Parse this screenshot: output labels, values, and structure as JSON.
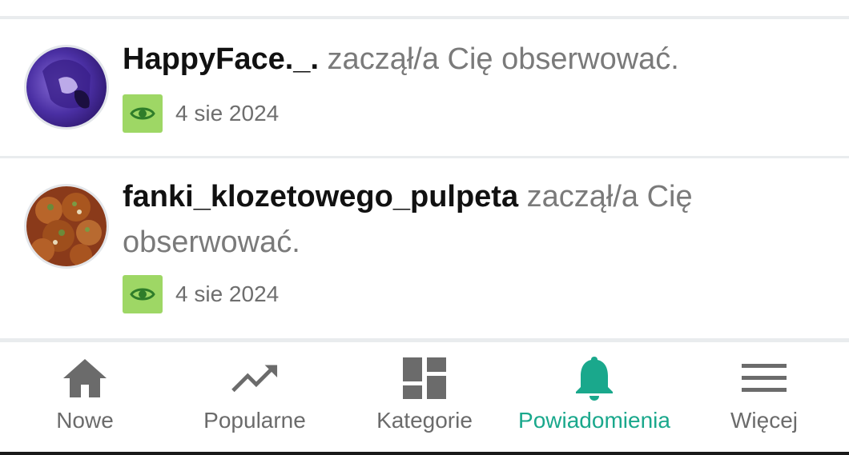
{
  "notifications": [
    {
      "username": "HappyFace._.",
      "action": " zaczął/a Cię obserwować.",
      "date": "4 sie 2024",
      "badge_icon": "eye-icon"
    },
    {
      "username": "fanki_klozetowego_pulpeta",
      "action": " zaczął/a Cię obserwować.",
      "date": "4 sie 2024",
      "badge_icon": "eye-icon"
    }
  ],
  "nav": {
    "items": [
      {
        "label": "Nowe",
        "icon": "home-icon"
      },
      {
        "label": "Popularne",
        "icon": "trending-icon"
      },
      {
        "label": "Kategorie",
        "icon": "categories-icon"
      },
      {
        "label": "Powiadomienia",
        "icon": "bell-icon",
        "active": true
      },
      {
        "label": "Więcej",
        "icon": "menu-icon"
      }
    ]
  },
  "colors": {
    "accent": "#1aa88c",
    "badge": "#9ed765",
    "badge_icon": "#2f7d2a"
  }
}
